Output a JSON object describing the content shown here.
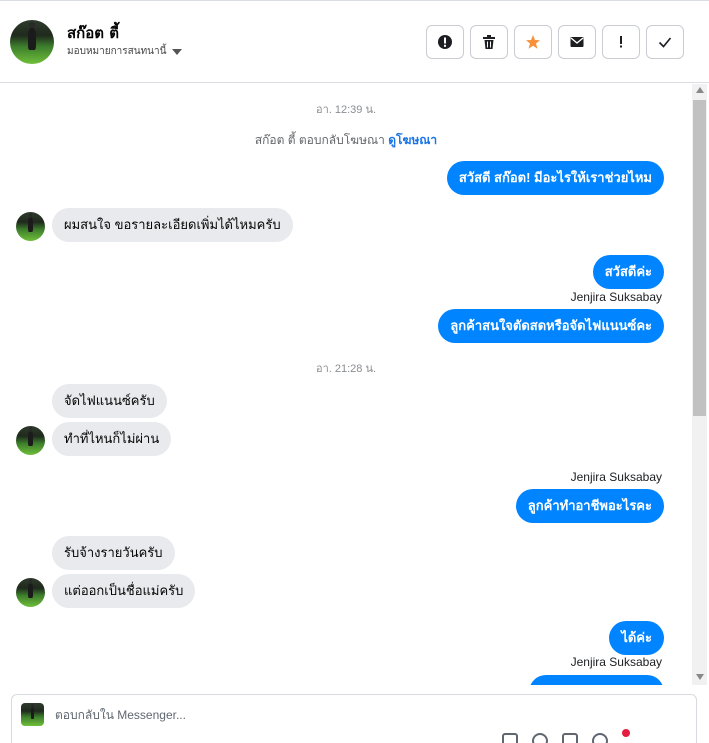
{
  "header": {
    "contact_name": "สก๊อต ตี้",
    "assign_label": "มอบหมายการสนทนานี้",
    "actions": [
      {
        "name": "report-button",
        "icon": "exclamation-circle-icon",
        "color": "#1c1e21"
      },
      {
        "name": "delete-button",
        "icon": "trash-icon",
        "color": "#1c1e21"
      },
      {
        "name": "star-button",
        "icon": "star-icon",
        "color": "#f7923b"
      },
      {
        "name": "mark-unread-button",
        "icon": "envelope-icon",
        "color": "#1c1e21"
      },
      {
        "name": "follow-up-button",
        "icon": "exclamation-icon",
        "color": "#1c1e21"
      },
      {
        "name": "done-button",
        "icon": "check-icon",
        "color": "#1c1e21"
      }
    ]
  },
  "thread": {
    "time_1": "อา. 12:39 น.",
    "ad_reply_text": "สก๊อต ตี้ ตอบกลับโฆษณา",
    "ad_link": "ดูโฆษณา",
    "msg_1": "สวัสดี สก๊อต! มีอะไรให้เราช่วยไหม",
    "msg_2": "ผมสนใจ ขอรายละเอียดเพิ่มได้ไหมครับ",
    "msg_3": "สวัสดีค่ะ",
    "sender_1": "Jenjira Suksabay",
    "msg_4": "ลูกค้าสนใจตัดสดหรือจัดไฟแนนซ์คะ",
    "time_2": "อา. 21:28 น.",
    "msg_5": "จัดไฟแนนซ์ครับ",
    "msg_6": "ทำที่ไหนก็ไม่ผ่าน",
    "sender_2": "Jenjira Suksabay",
    "msg_7": "ลูกค้าทำอาชีพอะไรคะ",
    "msg_8": "รับจ้างรายวันครับ",
    "msg_9": "แต่ออกเป็นชื่อแม่ครับ",
    "msg_10": "ได้ค่ะ",
    "sender_3": "Jenjira Suksabay"
  },
  "composer": {
    "placeholder": "ตอบกลับใน Messenger..."
  },
  "colors": {
    "outgoing_bubble": "#0084ff",
    "incoming_bubble": "#e9eaed",
    "link": "#1b74e4"
  }
}
